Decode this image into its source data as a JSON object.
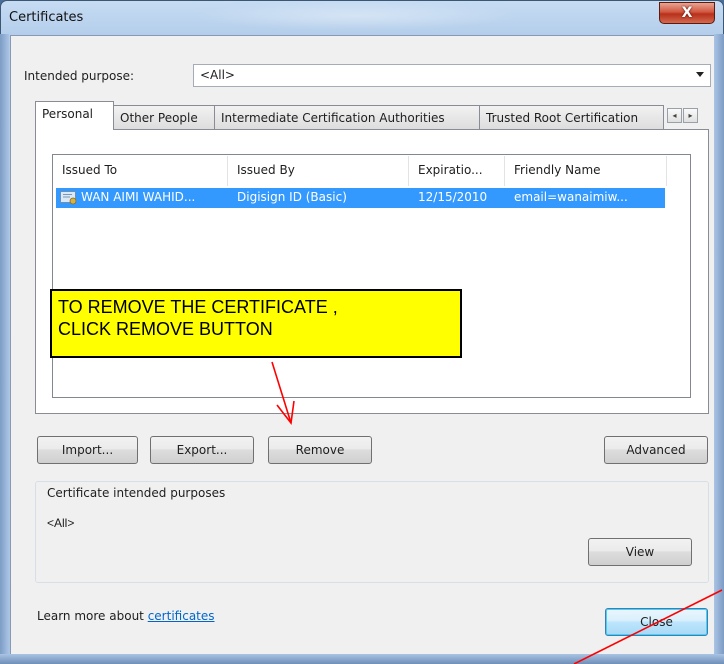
{
  "window": {
    "title": "Certificates",
    "close_glyph": "X"
  },
  "purpose": {
    "label": "Intended purpose:",
    "value": "<All>"
  },
  "tabs": [
    {
      "label": "Personal",
      "active": true
    },
    {
      "label": "Other People",
      "active": false
    },
    {
      "label": "Intermediate Certification Authorities",
      "active": false
    },
    {
      "label": "Trusted Root Certification",
      "active": false
    }
  ],
  "tab_scroll": {
    "left": "◂",
    "right": "▸"
  },
  "list": {
    "columns": [
      "Issued To",
      "Issued By",
      "Expiratio...",
      "Friendly Name"
    ],
    "rows": [
      {
        "issued_to": "WAN AIMI WAHID...",
        "issued_by": "Digisign ID (Basic)",
        "expiration": "12/15/2010",
        "friendly_name": "email=wanaimiw...",
        "selected": true,
        "icon": "certificate-icon"
      }
    ]
  },
  "annotation": {
    "text_line1": "TO REMOVE THE CERTIFICATE ,",
    "text_line2": "CLICK REMOVE BUTTON",
    "color": "#ffff00",
    "arrow_color": "#ff0000"
  },
  "buttons": {
    "import": "Import...",
    "export": "Export...",
    "remove": "Remove",
    "advanced": "Advanced",
    "view": "View",
    "close": "Close"
  },
  "purposes_group": {
    "label": "Certificate intended purposes",
    "value": "<All>"
  },
  "footer": {
    "learn_prefix": "Learn more about",
    "learn_link": "certificates"
  },
  "colors": {
    "selection": "#3399ff",
    "link": "#0066cc"
  }
}
